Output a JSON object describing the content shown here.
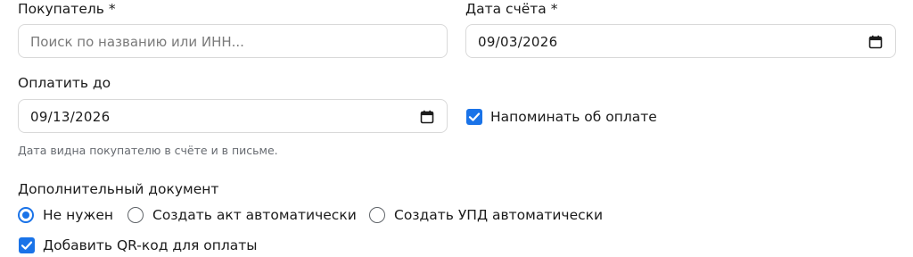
{
  "buyer": {
    "label": "Покупатель *",
    "placeholder": "Поиск по названию или ИНН..."
  },
  "invoice_date": {
    "label": "Дата счёта *",
    "value": "09/03/2026"
  },
  "pay_by": {
    "label": "Оплатить до",
    "value": "09/13/2026",
    "hint": "Дата видна покупателю в счёте и в письме."
  },
  "remind": {
    "label": "Напоминать об оплате",
    "checked": true
  },
  "extra_document": {
    "label": "Дополнительный документ",
    "options": [
      {
        "label": "Не нужен",
        "selected": true
      },
      {
        "label": "Создать акт автоматически",
        "selected": false
      },
      {
        "label": "Создать УПД автоматически",
        "selected": false
      }
    ]
  },
  "qr": {
    "label": "Добавить QR-код для оплаты",
    "checked": true
  },
  "colors": {
    "accent": "#1a73e8",
    "border": "#d9d9d9",
    "hint": "#666a70"
  }
}
